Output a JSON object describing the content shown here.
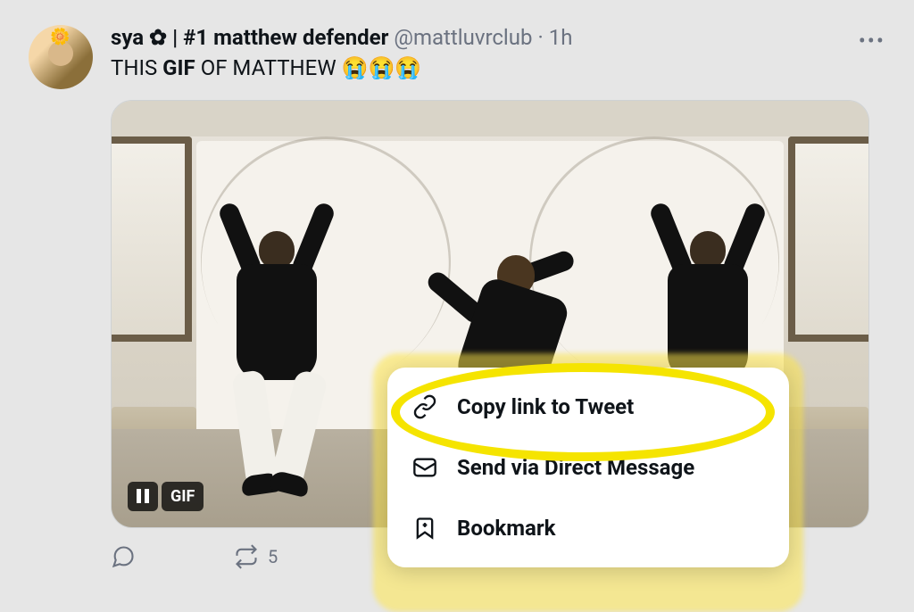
{
  "tweet": {
    "display_name": "sya ✿ | #1 matthew defender",
    "handle": "@mattluvrclub",
    "separator": "·",
    "time": "1h",
    "text_prefix": "THIS ",
    "text_bold": "GIF",
    "text_suffix": " OF MATTHEW ",
    "emojis": "😭😭😭"
  },
  "media": {
    "pause_label": "pause",
    "gif_label": "GIF"
  },
  "actions": {
    "retweet_count": "5"
  },
  "share_menu": {
    "items": [
      {
        "label": "Copy link to Tweet",
        "icon": "link-icon"
      },
      {
        "label": "Send via Direct Message",
        "icon": "envelope-icon"
      },
      {
        "label": "Bookmark",
        "icon": "bookmark-icon"
      }
    ]
  }
}
